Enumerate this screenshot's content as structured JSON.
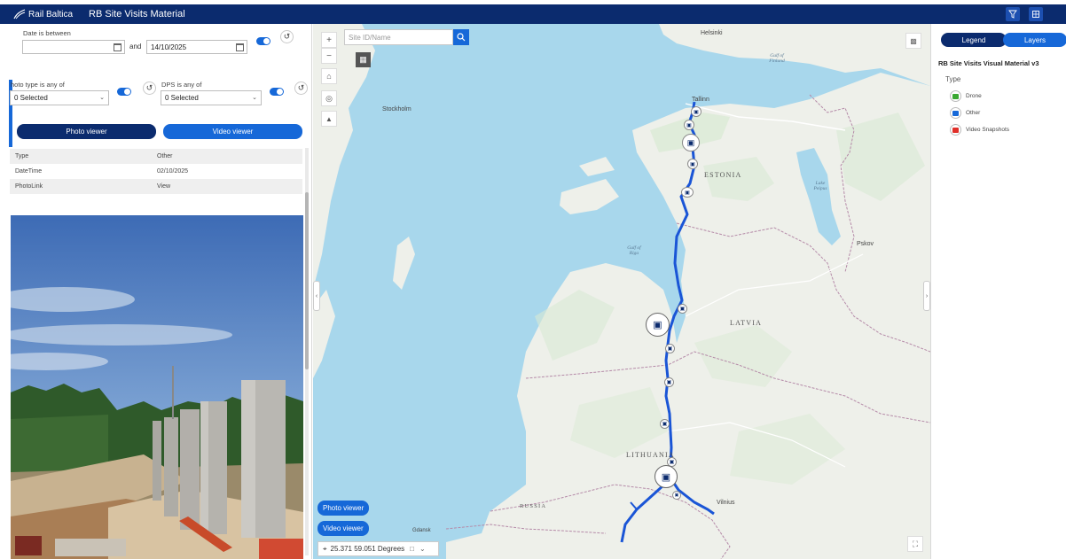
{
  "header": {
    "logo_text": "Rail Baltica",
    "title": "RB Site Visits Material",
    "buttons": [
      "filter-icon",
      "layers-tool-icon"
    ]
  },
  "filters": {
    "date_label": "Date is between",
    "date_from": "",
    "and_label": "and",
    "date_to": "14/10/2025",
    "photo_type_label": "hoto type is any of",
    "photo_type_value": "0 Selected",
    "dps_label": "DPS is any of",
    "dps_value": "0 Selected"
  },
  "buttons": {
    "photo_viewer": "Photo viewer",
    "video_viewer": "Video viewer"
  },
  "attributes": [
    {
      "field": "Type",
      "value": "Other"
    },
    {
      "field": "DateTime",
      "value": "02/10/2025"
    },
    {
      "field": "PhotoLink",
      "value": "View"
    }
  ],
  "map": {
    "search_placeholder": "Site ID/Name",
    "labels": {
      "helsinki": "Helsinki",
      "stockholm": "Stockholm",
      "tallinn": "Tallinn",
      "estonia": "ESTONIA",
      "latvia": "LATVIA",
      "lithuania": "LITHUANIA",
      "russia": "RUSSIA",
      "pskov": "Pskov",
      "vilnius": "Vilnius",
      "gdansk": "Gdansk",
      "gulf_finland": "Gulf of Finland",
      "gulf_riga": "Gulf of Riga",
      "lake_peipus": "Lake Peipus"
    },
    "photo_viewer_btn": "Photo viewer",
    "video_viewer_btn": "Video viewer",
    "coordinates": "25.371 59.051 Degrees"
  },
  "legend_panel": {
    "tab_legend": "Legend",
    "tab_layers": "Layers",
    "layer_title": "RB Site Visits Visual Material v3",
    "field_label": "Type",
    "items": [
      {
        "label": "Drone",
        "color": "#3aa832"
      },
      {
        "label": "Other",
        "color": "#1668d8"
      },
      {
        "label": "Video Snapshots",
        "color": "#e0302a"
      }
    ]
  },
  "colors": {
    "header": "#0b2b6e",
    "accent": "#1668d8",
    "route": "#1a55d6"
  }
}
